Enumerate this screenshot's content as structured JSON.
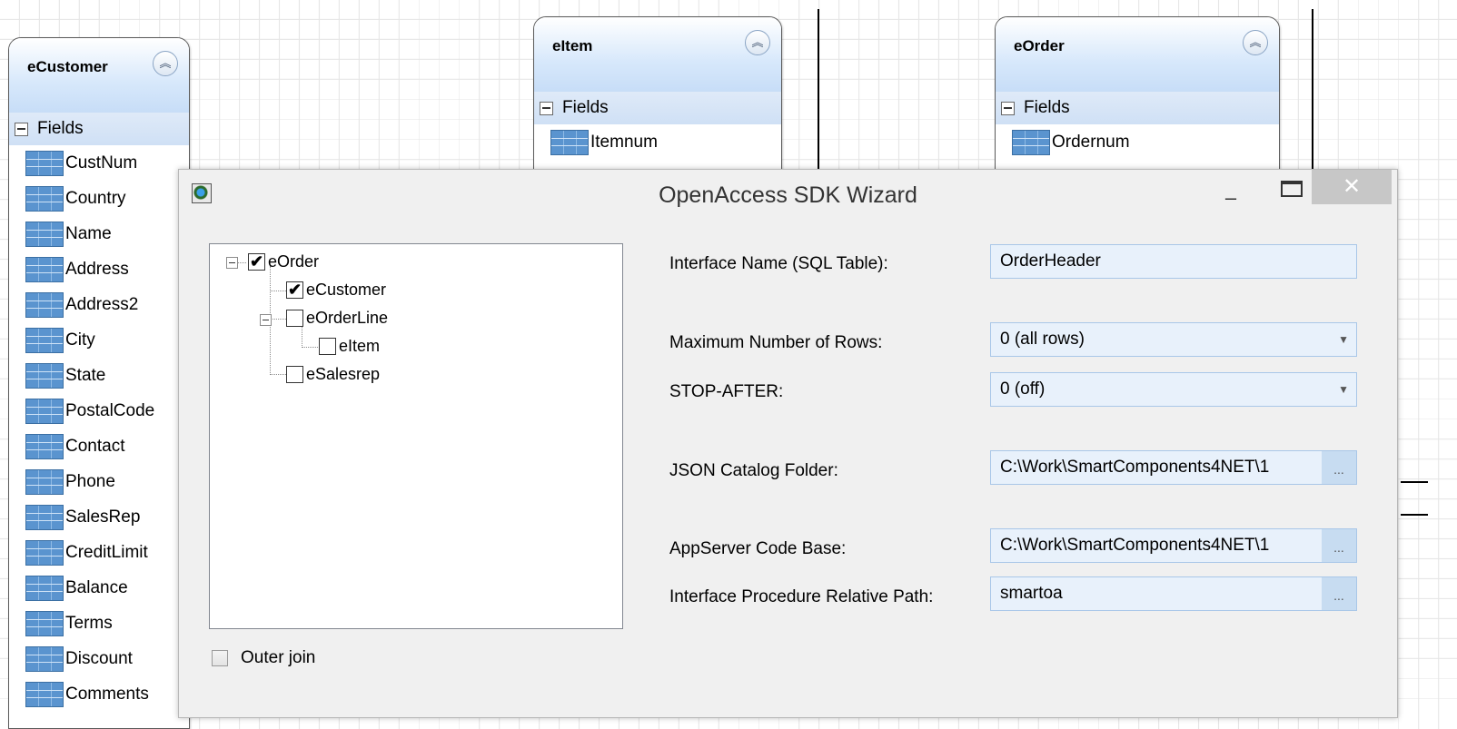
{
  "entities": {
    "customer": {
      "title": "eCustomer",
      "section": "Fields",
      "fields": [
        "CustNum",
        "Country",
        "Name",
        "Address",
        "Address2",
        "City",
        "State",
        "PostalCode",
        "Contact",
        "Phone",
        "SalesRep",
        "CreditLimit",
        "Balance",
        "Terms",
        "Discount",
        "Comments"
      ]
    },
    "item": {
      "title": "eItem",
      "section": "Fields",
      "fields": [
        "Itemnum"
      ]
    },
    "order": {
      "title": "eOrder",
      "section": "Fields",
      "fields": [
        "Ordernum"
      ]
    }
  },
  "icons": {
    "collapse": "double-chevron-up-icon",
    "field": "table-field-icon"
  },
  "wizard": {
    "title": "OpenAccess SDK Wizard",
    "min_glyph": "–",
    "close_glyph": "✕",
    "check_glyph": "✔",
    "tree": [
      {
        "label": "eOrder",
        "checked": true
      },
      {
        "label": "eCustomer",
        "checked": true
      },
      {
        "label": "eOrderLine",
        "checked": false
      },
      {
        "label": "eItem",
        "checked": false
      },
      {
        "label": "eSalesrep",
        "checked": false
      }
    ],
    "outer_join_label": "Outer join",
    "outer_join_checked": false,
    "form": {
      "interface_name_label": "Interface Name (SQL Table):",
      "interface_name_value": "OrderHeader",
      "max_rows_label": "Maximum Number of Rows:",
      "max_rows_value": "0 (all rows)",
      "stop_after_label": "STOP-AFTER:",
      "stop_after_value": "0 (off)",
      "json_folder_label": "JSON Catalog Folder:",
      "json_folder_value": "C:\\Work\\SmartComponents4NET\\1",
      "appserver_label": "AppServer Code Base:",
      "appserver_value": "C:\\Work\\SmartComponents4NET\\1",
      "proc_path_label": "Interface Procedure Relative Path:",
      "proc_path_value": "smartoa",
      "browse_label": "...",
      "dropdown_glyph": "▼"
    }
  },
  "colors": {
    "header_blue": "#c7ddf7",
    "input_bg": "#e8f1fb",
    "close_bg": "#c7c7c7"
  }
}
